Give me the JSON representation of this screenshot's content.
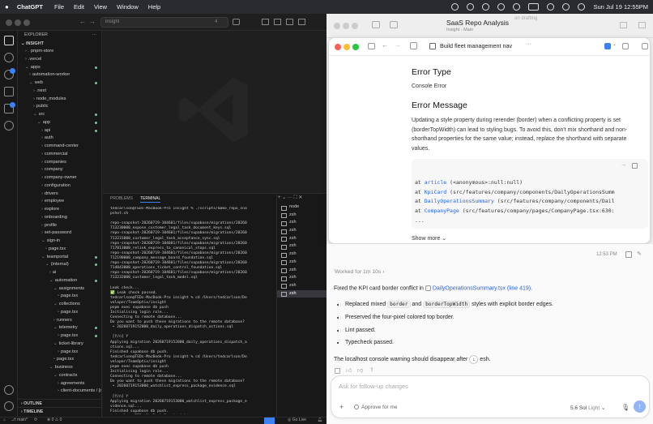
{
  "menubar": {
    "app": "ChatGPT",
    "items": [
      "File",
      "Edit",
      "View",
      "Window",
      "Help"
    ],
    "clock": "Sun Jul 19  12:55PM"
  },
  "vscode": {
    "search_placeholder": "insight",
    "scm_count": "4",
    "explorer_label": "EXPLORER",
    "workspace": "INSIGHT",
    "tree": [
      {
        "label": "pnpm-store",
        "depth": 1,
        "prefix": "› .",
        "dot": false
      },
      {
        "label": ".vercel",
        "depth": 1,
        "prefix": "›",
        "dot": false
      },
      {
        "label": "apps",
        "depth": 1,
        "prefix": "⌄",
        "dot": true
      },
      {
        "label": "automation-worker",
        "depth": 2,
        "prefix": "›",
        "dot": false
      },
      {
        "label": "web",
        "depth": 2,
        "prefix": "⌄",
        "dot": true
      },
      {
        "label": ".next",
        "depth": 3,
        "prefix": "›",
        "dot": false
      },
      {
        "label": "node_modules",
        "depth": 3,
        "prefix": "›",
        "dot": false
      },
      {
        "label": "public",
        "depth": 3,
        "prefix": "›",
        "dot": false
      },
      {
        "label": "src",
        "depth": 3,
        "prefix": "⌄",
        "dot": true
      },
      {
        "label": "app",
        "depth": 4,
        "prefix": "⌄",
        "dot": true
      },
      {
        "label": "api",
        "depth": 5,
        "prefix": "›",
        "dot": true
      },
      {
        "label": "auth",
        "depth": 5,
        "prefix": "›",
        "dot": false
      },
      {
        "label": "command-center",
        "depth": 5,
        "prefix": "›",
        "dot": false
      },
      {
        "label": "commercial",
        "depth": 5,
        "prefix": "›",
        "dot": false
      },
      {
        "label": "companies",
        "depth": 5,
        "prefix": "›",
        "dot": false
      },
      {
        "label": "company",
        "depth": 5,
        "prefix": "›",
        "dot": false
      },
      {
        "label": "company-owner",
        "depth": 5,
        "prefix": "›",
        "dot": false
      },
      {
        "label": "configuration",
        "depth": 5,
        "prefix": "›",
        "dot": false
      },
      {
        "label": "drivers",
        "depth": 5,
        "prefix": "›",
        "dot": false
      },
      {
        "label": "employee",
        "depth": 5,
        "prefix": "›",
        "dot": false
      },
      {
        "label": "explore",
        "depth": 5,
        "prefix": "›",
        "dot": false
      },
      {
        "label": "onboarding",
        "depth": 5,
        "prefix": "›",
        "dot": false
      },
      {
        "label": "profile",
        "depth": 5,
        "prefix": "›",
        "dot": false
      },
      {
        "label": "set-password",
        "depth": 5,
        "prefix": "›",
        "dot": false
      },
      {
        "label": "sign-in",
        "depth": 5,
        "prefix": "⌄",
        "dot": false
      },
      {
        "label": "page.tsx",
        "depth": 6,
        "prefix": "",
        "dot": false
      },
      {
        "label": "teamportal",
        "depth": 5,
        "prefix": "⌄",
        "dot": true
      },
      {
        "label": "(internal)",
        "depth": 6,
        "prefix": "⌄",
        "dot": true
      },
      {
        "label": "ai",
        "depth": 7,
        "prefix": "›",
        "dot": false
      },
      {
        "label": "automation",
        "depth": 7,
        "prefix": "⌄",
        "dot": true
      },
      {
        "label": "assignments",
        "depth": 8,
        "prefix": "⌄",
        "dot": false
      },
      {
        "label": "page.tsx",
        "depth": 9,
        "prefix": "",
        "dot": false
      },
      {
        "label": "collections",
        "depth": 8,
        "prefix": "⌄",
        "dot": false
      },
      {
        "label": "page.tsx",
        "depth": 9,
        "prefix": "",
        "dot": false
      },
      {
        "label": "runners",
        "depth": 8,
        "prefix": "›",
        "dot": false
      },
      {
        "label": "telemetry",
        "depth": 8,
        "prefix": "⌄",
        "dot": true
      },
      {
        "label": "page.tsx",
        "depth": 9,
        "prefix": "",
        "dot": true
      },
      {
        "label": "ticket-library",
        "depth": 8,
        "prefix": "⌄",
        "dot": false
      },
      {
        "label": "page.tsx",
        "depth": 9,
        "prefix": "",
        "dot": false
      },
      {
        "label": "page.tsx",
        "depth": 8,
        "prefix": "",
        "dot": false
      },
      {
        "label": "business",
        "depth": 7,
        "prefix": "⌄",
        "dot": false
      },
      {
        "label": "contracts",
        "depth": 8,
        "prefix": "⌄",
        "dot": false
      },
      {
        "label": "agreements",
        "depth": 9,
        "prefix": "›",
        "dot": false
      },
      {
        "label": "client-documents / [do...",
        "depth": 9,
        "prefix": "›",
        "dot": false
      }
    ],
    "outline": "OUTLINE",
    "timeline": "TIMELINE",
    "panel_tabs": [
      "PROBLEMS",
      "TERMINAL"
    ],
    "terminal_text": "tedcarlson@TEDs-MacBook-Pro insight % ./scripts/make_repo_sna\npshot.sh\n\nrepo-snapshot-20260719-104601/files/supabase/migrations/20260\n713230000_expose_customer_legal_task_document_keys.sql\nrepo-snapshot-20260719-104601/files/supabase/migrations/20260\n713231000_customer_legal_task_acceptance_sync.sql\nrepo-snapshot-20260719-104601/files/supabase/migrations/20260\n717013000_relink_express_to_canonical_stops.sql\nrepo-snapshot-20260719-104601/files/supabase/migrations/20260\n712190000_company_message_board_foundation.sql\nrepo-snapshot-20260719-104601/files/supabase/migrations/20260\n714043000_operations_ticket_control_foundation.sql\nrepo-snapshot-20260719-104601/files/supabase/migrations/20260\n713232000_customer_legal_task_model.sql\n\nLeak check...\n✅ Leak check passed.\ntedcarlson@TEDs-MacBook-Pro insight % cd /Users/tedcarlson/De\nveloper/TeamOptix/insight\npnpm exec supabase db push\nInitialising login role...\nConnecting to remote database...\nDo you want to push these migrations to the remote database?\n • 20260719152000_daily_operations_dispatch_actions.sql\n\n [Y/n] Y\nApplying migration 20260719152000_daily_operations_dispatch_a\nctions.sql...\nFinished supabase db push.\ntedcarlson@TEDs-MacBook-Pro insight % cd /Users/tedcarlson/De\nveloper/TeamOptix/insight\npnpm exec supabase db push\nInitialising login role...\nConnecting to remote database...\nDo you want to push these migrations to the remote database?\n • 20260719153000_watchlist_express_package_evidence.sql\n\n [Y/n] Y\nApplying migration 20260719153000_watchlist_express_package_e\nvidence.sql...\nFinished supabase db push.\ntedcarlson@TEDs-MacBook-Pro insight % ▯",
    "terminal_tabs": [
      "node",
      "zsh",
      "zsh",
      "zsh",
      "zsh",
      "zsh",
      "zsh",
      "zsh",
      "zsh",
      "zsh",
      "zsh",
      "zsh"
    ],
    "status": {
      "branch": "main*",
      "errors": "0",
      "warnings": "0",
      "golive": "Go Live"
    }
  },
  "right": {
    "back_title": "SaaS Repo Analysis",
    "back_subtitle": "Insight - Main",
    "back_status": "on drafting",
    "thread_title": "Build fleet management nav",
    "error_type_heading": "Error Type",
    "error_type": "Console Error",
    "error_message_heading": "Error Message",
    "error_message": "Updating a style property during rerender (border) when a conflicting property is set (borderTopWidth) can lead to styling bugs. To avoid this, don't mix shorthand and non-shorthand properties for the same value; instead, replace the shorthand with separate values.",
    "stack": [
      {
        "at": "at",
        "fn": "article",
        "rest": " (<anonymous>:null:null)"
      },
      {
        "at": "at",
        "fn": "KpiCard",
        "rest": " (src/features/company/components/DailyOperationsSumm"
      },
      {
        "at": "at",
        "fn": "DailyOperationsSummary",
        "rest": " (src/features/company/components/Dail"
      },
      {
        "at": "at",
        "fn": "CompanyPage",
        "rest": " (src/features/company/pages/CompanyPage.tsx:630:"
      }
    ],
    "stack_ellipsis": "...",
    "show_more": "Show more",
    "msg_time": "12:53 PM",
    "worked_for": "Worked for 1m 10s",
    "summary_pre": "Fixed the KPI card border conflict in ",
    "summary_file": "DailyOperationsSummary.tsx (line 419)",
    "summary_post": ".",
    "bullet1_pre": "Replaced mixed ",
    "bullet1_c1": "border",
    "bullet1_mid": " and ",
    "bullet1_c2": "borderTopWidth",
    "bullet1_post": " styles with explicit border edges.",
    "bullet2": "Preserved the four-pixel colored top border.",
    "bullet3": "Lint passed.",
    "bullet4": "Typecheck passed.",
    "closing_a": "The localhost console warning should disappear after",
    "closing_b": "esh.",
    "composer_placeholder": "Ask for follow-up changes",
    "approve": "Approve for me",
    "model": "5.6 Sol",
    "effort": "Light",
    "accent": "#3b82f6"
  }
}
